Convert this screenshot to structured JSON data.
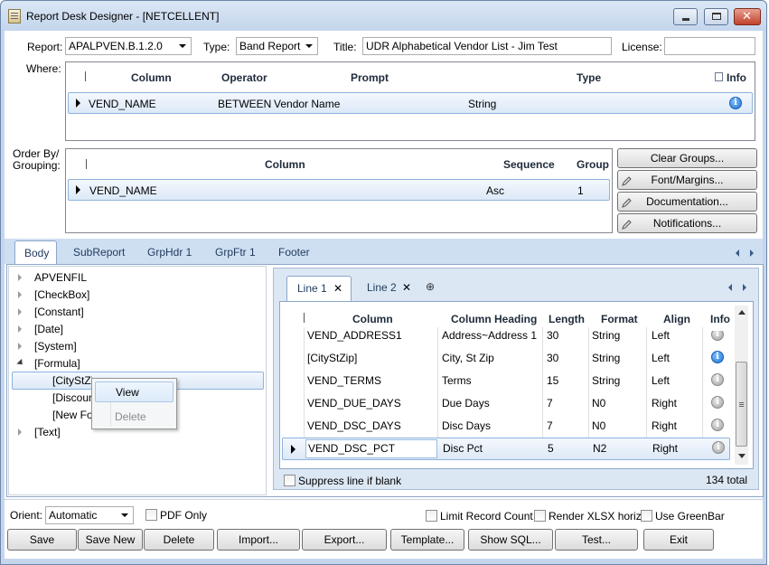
{
  "window": {
    "title": "Report Desk Designer - [NETCELLENT]"
  },
  "header": {
    "report_label": "Report:",
    "report_value": "APALPVEN.B.1.2.0",
    "type_label": "Type:",
    "type_value": "Band Report",
    "title_label": "Title:",
    "title_value": "UDR Alphabetical Vendor List - Jim Test",
    "license_label": "License:",
    "license_value": ""
  },
  "where": {
    "label": "Where:",
    "columns": {
      "column": "Column",
      "operator": "Operator",
      "prompt": "Prompt",
      "type": "Type",
      "info": "Info"
    },
    "rows": [
      {
        "column": "VEND_NAME",
        "operator": "BETWEEN",
        "prompt": "Vendor Name",
        "type": "String"
      }
    ]
  },
  "order": {
    "label_line1": "Order By/",
    "label_line2": "Grouping:",
    "columns": {
      "column": "Column",
      "sequence": "Sequence",
      "group": "Group"
    },
    "rows": [
      {
        "column": "VEND_NAME",
        "sequence": "Asc",
        "group": "1"
      }
    ]
  },
  "side_buttons": {
    "clear_groups": "Clear Groups...",
    "font_margins": "Font/Margins...",
    "documentation": "Documentation...",
    "notifications": "Notifications..."
  },
  "tabs": [
    "Body",
    "SubReport",
    "GrpHdr 1",
    "GrpFtr 1",
    "Footer"
  ],
  "tree": {
    "items": [
      "APVENFIL",
      "[CheckBox]",
      "[Constant]",
      "[Date]",
      "[System]",
      "[Formula]"
    ],
    "children": [
      "[CityStZip]",
      "[Discount]",
      "[New Formula]"
    ],
    "last": "[Text]"
  },
  "context_menu": {
    "view": "View",
    "delete": "Delete"
  },
  "lines": {
    "tabs": [
      "Line 1",
      "Line 2"
    ],
    "columns": {
      "column": "Column",
      "heading": "Column Heading",
      "length": "Length",
      "format": "Format",
      "align": "Align",
      "info": "Info"
    },
    "rows": [
      {
        "column": "VEND_ADDRESS1",
        "heading": "Address~Address 1",
        "length": "30",
        "format": "String",
        "align": "Left",
        "info": "grey"
      },
      {
        "column": "[CityStZip]",
        "heading": "City, St Zip",
        "length": "30",
        "format": "String",
        "align": "Left",
        "info": "blue"
      },
      {
        "column": "VEND_TERMS",
        "heading": "Terms",
        "length": "15",
        "format": "String",
        "align": "Left",
        "info": "grey"
      },
      {
        "column": "VEND_DUE_DAYS",
        "heading": "Due Days",
        "length": "7",
        "format": "N0",
        "align": "Right",
        "info": "grey"
      },
      {
        "column": "VEND_DSC_DAYS",
        "heading": "Disc Days",
        "length": "7",
        "format": "N0",
        "align": "Right",
        "info": "grey"
      },
      {
        "column": "VEND_DSC_PCT",
        "heading": "Disc Pct",
        "length": "5",
        "format": "N2",
        "align": "Right",
        "info": "grey"
      }
    ],
    "suppress_label": "Suppress line if blank",
    "total": "134 total"
  },
  "footer": {
    "orient_label": "Orient:",
    "orient_value": "Automatic",
    "pdf_only": "PDF Only",
    "limit_record_count": "Limit Record Count",
    "render_xlsx": "Render XLSX horiz.",
    "use_greenbar": "Use GreenBar"
  },
  "buttons": {
    "save": "Save",
    "save_new": "Save New",
    "delete": "Delete",
    "import": "Import...",
    "export": "Export...",
    "template": "Template...",
    "show_sql": "Show SQL...",
    "test": "Test...",
    "exit": "Exit"
  },
  "colors": {
    "titlebar": "#c3d5ec",
    "selection": "#dde9f7",
    "close_button": "#c0422c",
    "info_icon": "#1f73d0"
  }
}
